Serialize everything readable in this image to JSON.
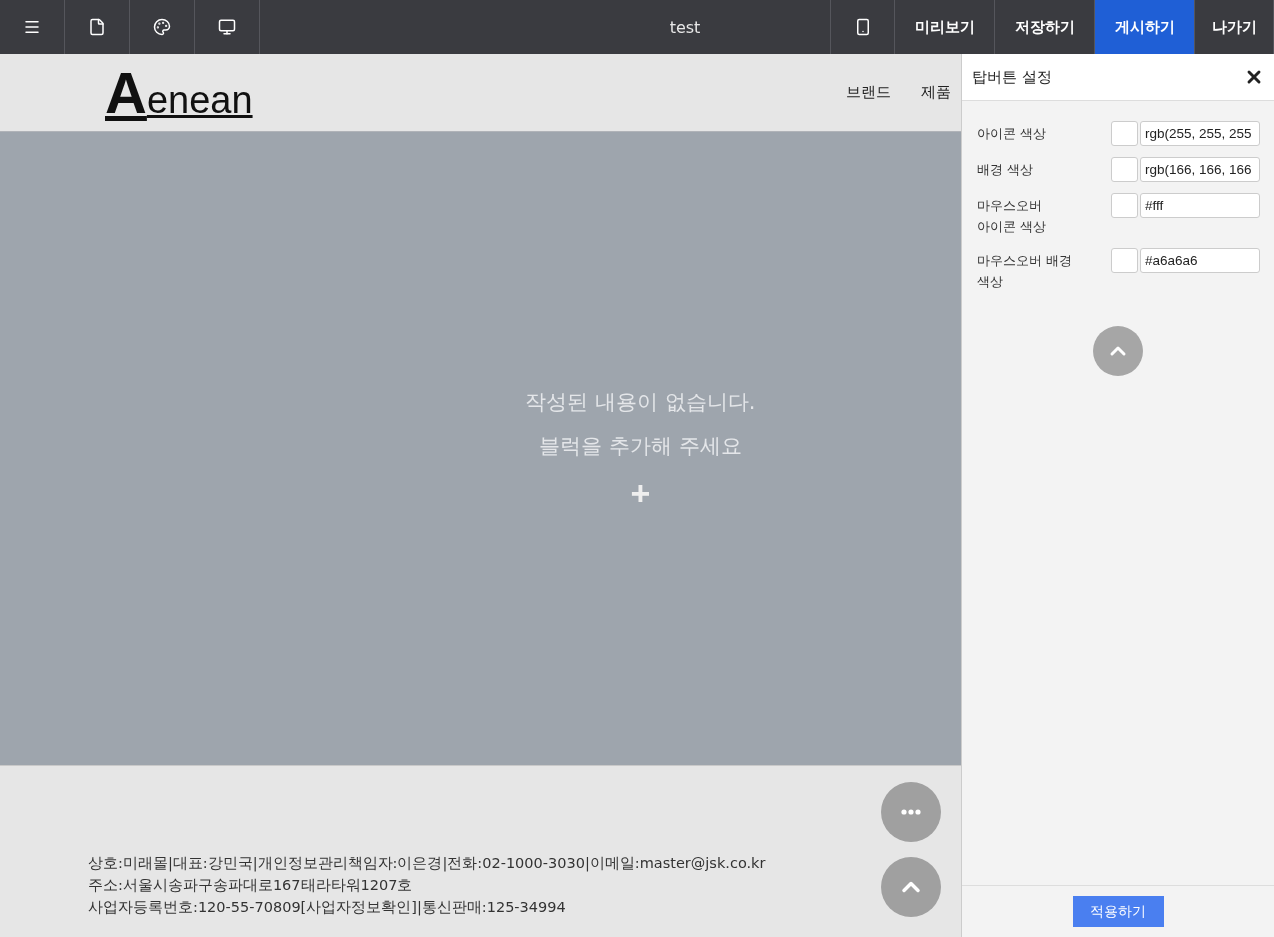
{
  "toolbar": {
    "icons": [
      {
        "kind": "menu"
      },
      {
        "kind": "page"
      },
      {
        "kind": "palette"
      },
      {
        "kind": "monitor"
      }
    ],
    "title": "test",
    "device": {
      "kind": "mobile"
    },
    "actions": [
      {
        "label": "미리보기",
        "selected": false
      },
      {
        "label": "저장하기",
        "selected": false
      },
      {
        "label": "게시하기",
        "selected": true
      },
      {
        "label": "나가기",
        "selected": false
      }
    ]
  },
  "site": {
    "logo_initial": "A",
    "logo_rest": "enean",
    "nav": [
      "브랜드",
      "제품"
    ],
    "empty": {
      "line1": "작성된 내용이 없습니다.",
      "line2": "블럭을 추가해 주세요",
      "add": "+"
    },
    "footer": [
      "상호:미래몰|대표:강민국|개인정보관리책임자:이은경|전화:02-1000-3030|이메일:master@jsk.co.kr",
      "주소:서울시송파구송파대로167태라타워1207호",
      "사업자등록번호:120-55-70809[사업자정보확인]|통신판매:125-34994"
    ]
  },
  "panel": {
    "title": "탑버튼 설정",
    "fields": [
      {
        "label": "아이콘 색상",
        "value": "rgb(255, 255, 255"
      },
      {
        "label": "배경 색상",
        "value": "rgb(166, 166, 166"
      },
      {
        "label": "마우스오버 아이콘 색상",
        "value": "#fff"
      },
      {
        "label": "마우스오버 배경 색상",
        "value": "#a6a6a6"
      }
    ],
    "apply": "적용하기"
  }
}
